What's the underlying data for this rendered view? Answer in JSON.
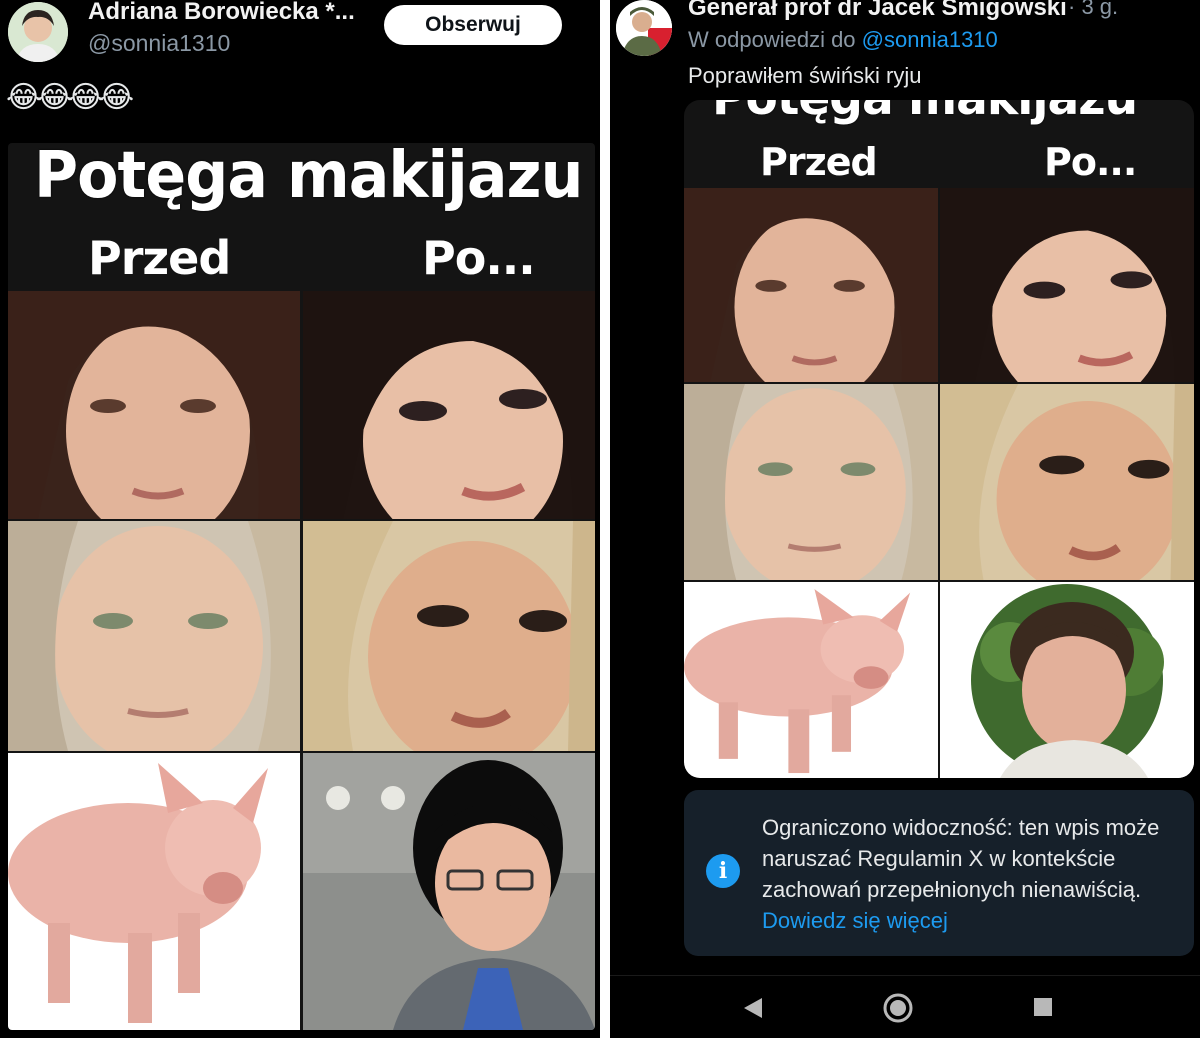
{
  "left_tweet": {
    "author_name": "Adriana Borowiecka *...",
    "handle": "@sonnia1310",
    "follow_label": "Obserwuj",
    "text": "😂😂😂😂",
    "meme": {
      "title": "Potęga makijazu",
      "before_label": "Przed",
      "after_label": "Po..."
    }
  },
  "right_tweet": {
    "author_name": "Generał prof dr Jacek Smigowski",
    "time": "· 3 g.",
    "reply_prefix": "W odpowiedzi do",
    "reply_mention": "@sonnia1310",
    "text": "Poprawiłem świński ryju",
    "meme": {
      "title": "Potęga makijazu",
      "before_label": "Przed",
      "after_label": "Po..."
    },
    "notice": {
      "icon": "info-icon",
      "text": "Ograniczono widoczność: ten wpis może naruszać Regulamin X w kontekście zachowań przepełnionych nienawiścią.",
      "link": "Dowiedz się więcej"
    }
  },
  "nav": {
    "back_icon": "triangle-back-icon",
    "home_icon": "circle-home-icon",
    "recent_icon": "square-recents-icon"
  },
  "colors": {
    "link": "#1d9bf0",
    "background": "#000000",
    "notice_bg": "#16202a",
    "muted": "#8b98a5"
  }
}
